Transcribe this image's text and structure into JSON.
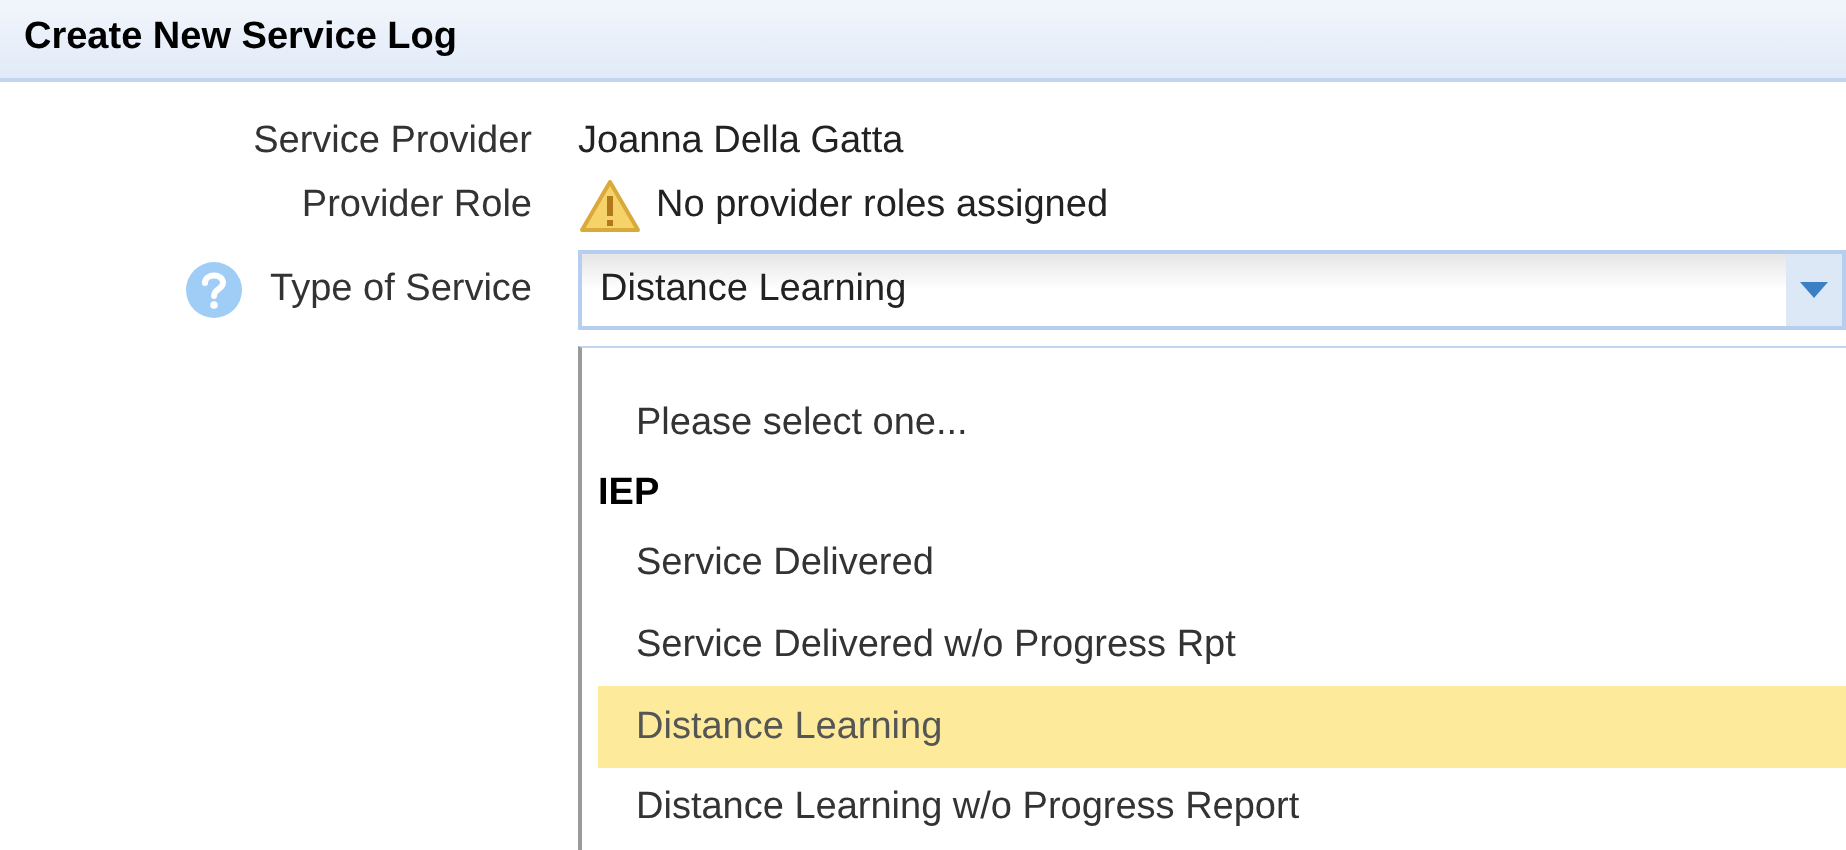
{
  "header": {
    "title": "Create New Service Log"
  },
  "fields": [
    {
      "label": "Service Provider",
      "kind": "text",
      "value": "Joanna Della Gatta"
    },
    {
      "label": "Provider Role",
      "kind": "warning",
      "value": "No provider roles assigned"
    },
    {
      "label": "Type of Service",
      "kind": "select",
      "help": true,
      "value": "Distance Learning"
    }
  ],
  "dropdown": {
    "options": [
      {
        "kind": "option",
        "label": "Please select one...",
        "selected": false
      },
      {
        "kind": "group",
        "label": "IEP"
      },
      {
        "kind": "option",
        "label": "Service Delivered",
        "selected": false
      },
      {
        "kind": "option",
        "label": "Service Delivered w/o Progress Rpt",
        "selected": false
      },
      {
        "kind": "option",
        "label": "Distance Learning",
        "selected": true
      },
      {
        "kind": "option",
        "label": "Distance Learning w/o Progress Report",
        "selected": false
      }
    ]
  }
}
